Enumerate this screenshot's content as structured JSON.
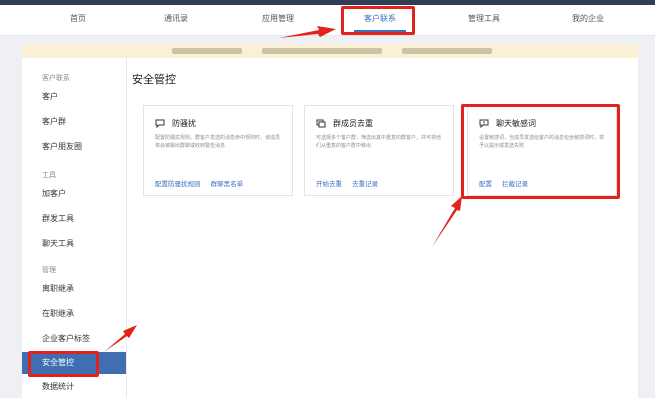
{
  "nav": {
    "items": [
      "首页",
      "通讯录",
      "应用管理",
      "客户联系",
      "管理工具",
      "我的企业"
    ],
    "active_index": 3
  },
  "sidebar": {
    "group_customer": "客户联系",
    "customer_items": [
      "客户",
      "客户群",
      "客户朋友圈"
    ],
    "group_tools": "工具",
    "tool_items": [
      "加客户",
      "群发工具",
      "聊天工具"
    ],
    "group_manage": "管理",
    "manage_items": [
      "离职继承",
      "在职继承",
      "企业客户标签",
      "安全管控",
      "数据统计"
    ],
    "active_item": "安全管控"
  },
  "main": {
    "title": "安全管控",
    "cards": [
      {
        "icon": "anti-harassment-icon",
        "title": "防骚扰",
        "desc": "配置防骚扰规则，群客户发送的消息命中规则时，该成员将会被踢出群聊或收到警告消息",
        "links": [
          "配置防骚扰规则",
          "群聊黑名单"
        ]
      },
      {
        "icon": "duplicate-members-icon",
        "title": "群成员去重",
        "desc": "可选择多个客户群，筛选出其中重复的群客户，并可将他们从重复的客户群中移出",
        "links": [
          "开始去重",
          "去重记录"
        ]
      },
      {
        "icon": "sensitive-words-icon",
        "title": "聊天敏感词",
        "desc": "设置敏感词，当成员发送给客户的消息包含敏感词时，将予以提示或发送失败",
        "links": [
          "配置",
          "拦截记录"
        ]
      }
    ]
  },
  "colors": {
    "accent": "#3a6fc4",
    "sidebar_active": "#3f6fb2",
    "highlight": "#e3231b",
    "banner": "#fbf0d5"
  }
}
